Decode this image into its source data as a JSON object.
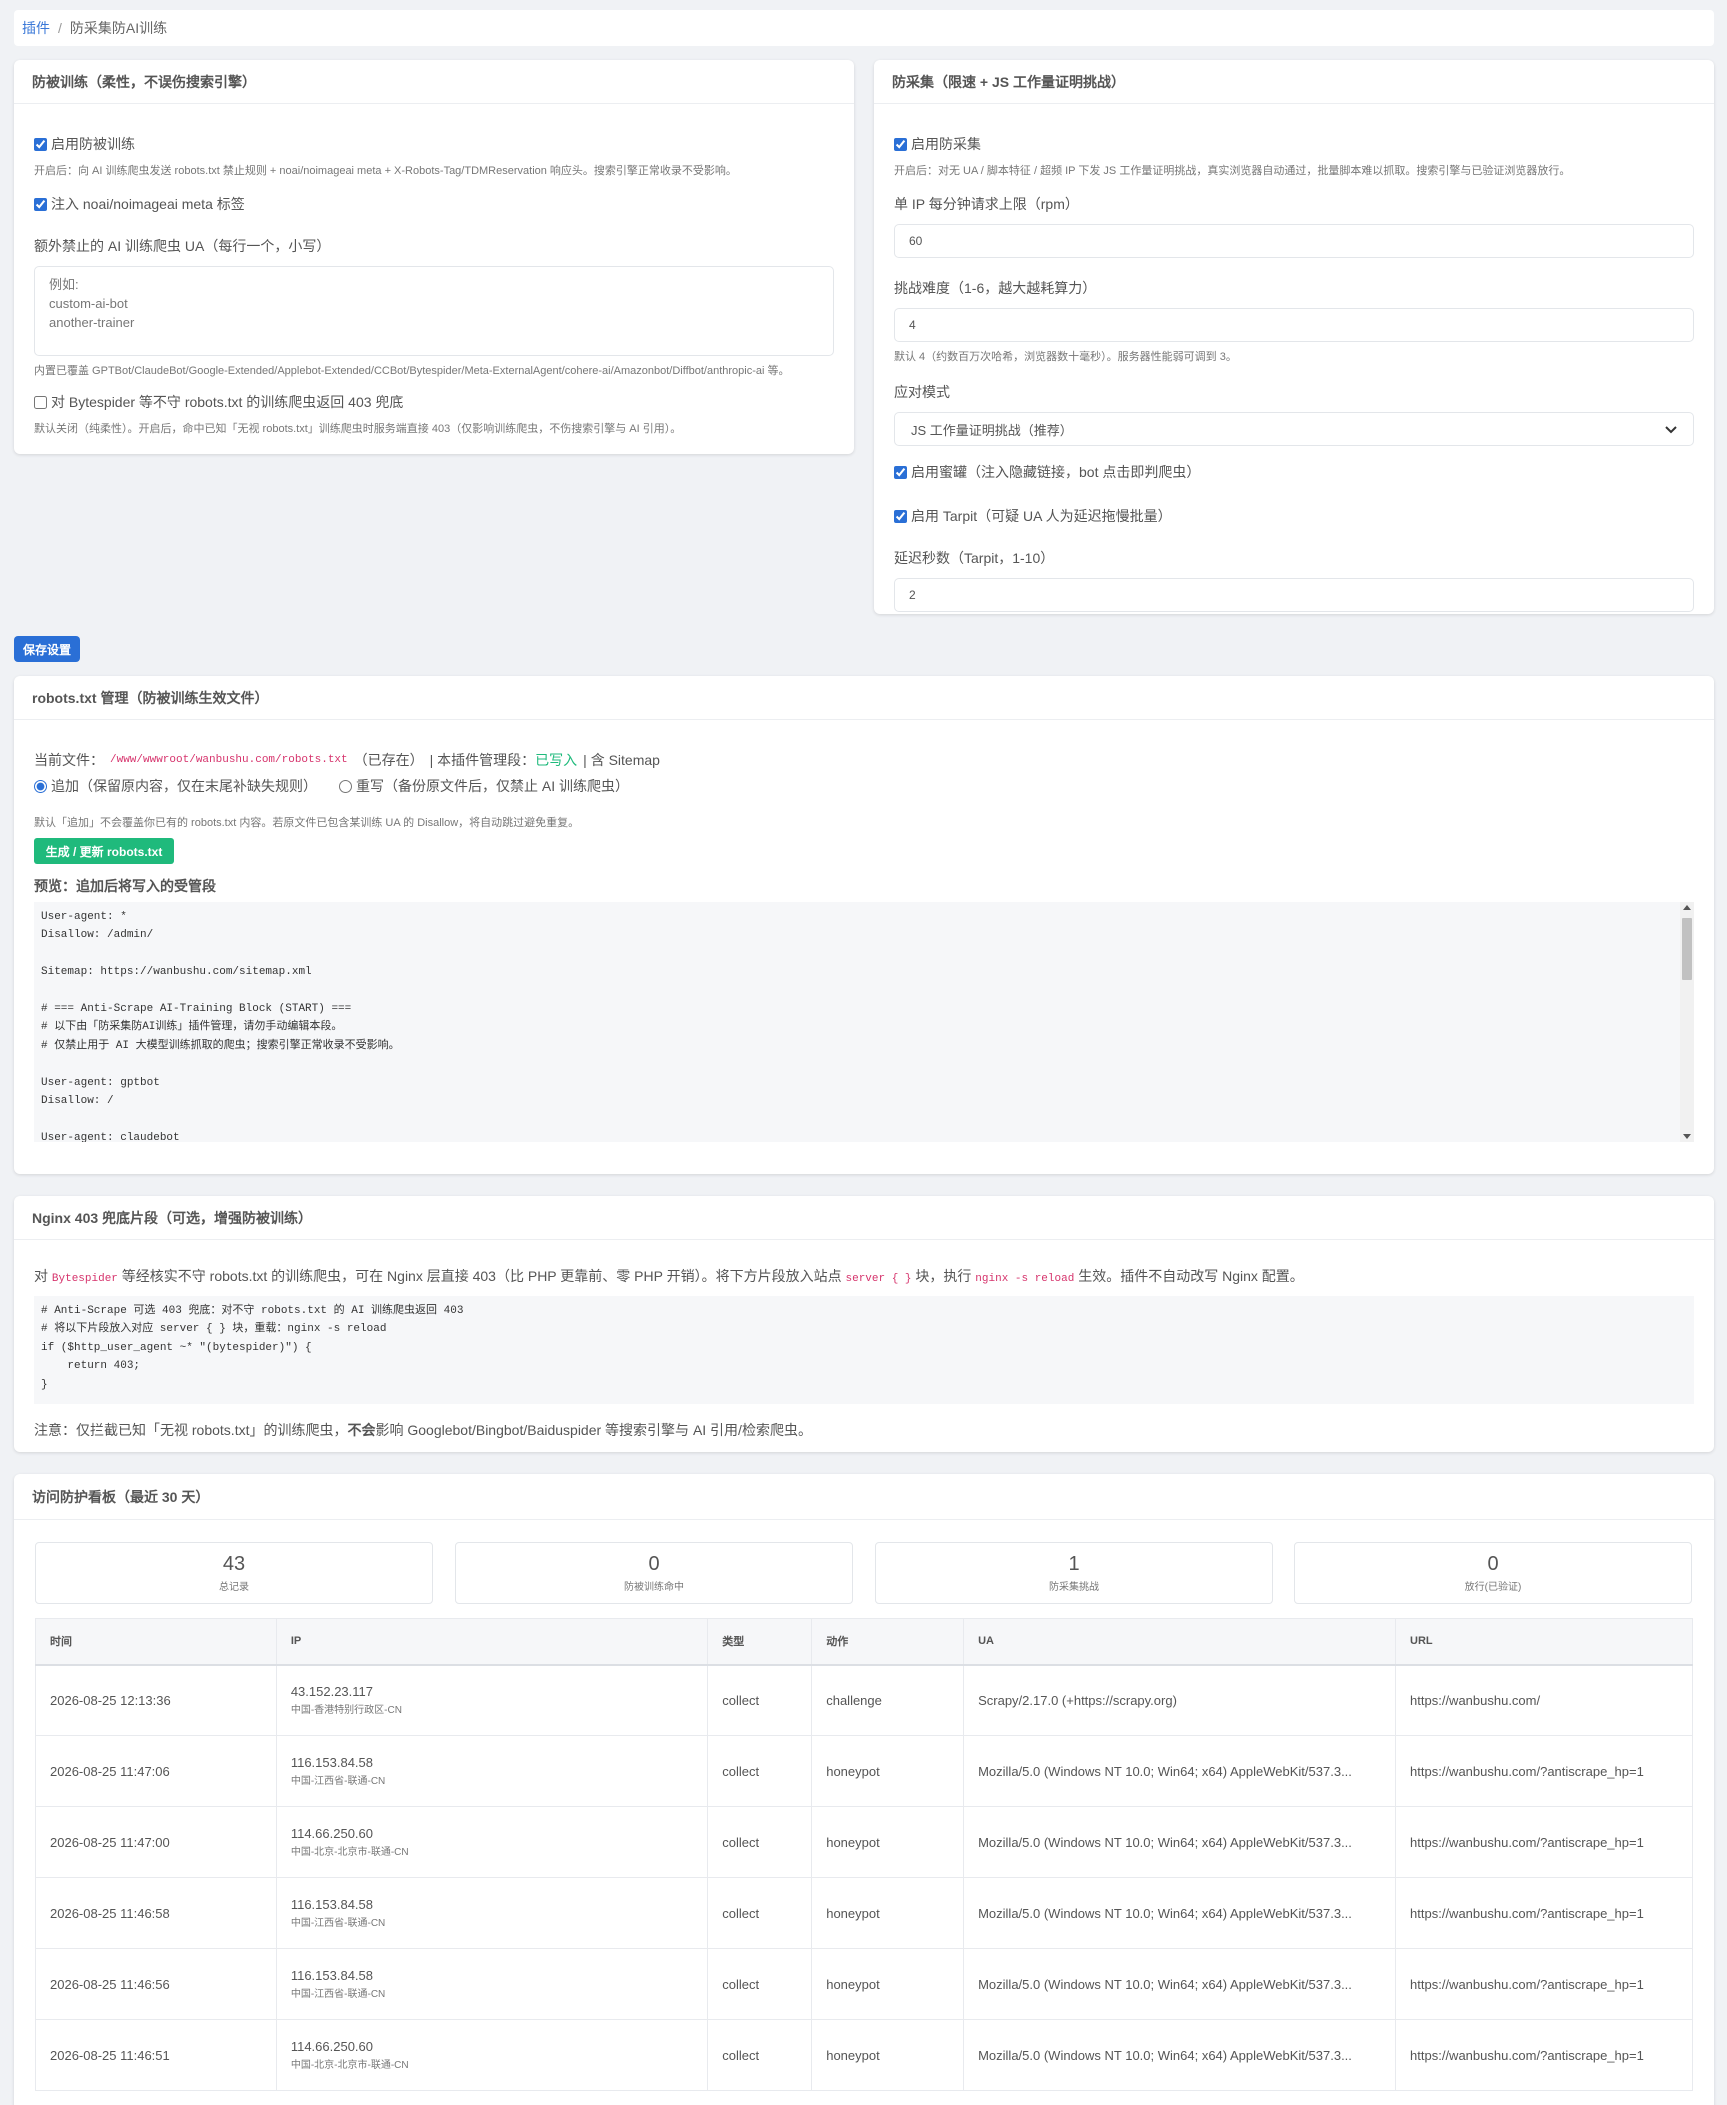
{
  "breadcrumb": {
    "link": "插件",
    "sep": "/",
    "current": "防采集防AI训练"
  },
  "train_card": {
    "title": "防被训练（柔性，不误伤搜索引擎）",
    "enable_label": "启用防被训练",
    "enable_help": "开启后：向 AI 训练爬虫发送 robots.txt 禁止规则 + noai/noimageai meta + X-Robots-Tag/TDMReservation 响应头。搜索引擎正常收录不受影响。",
    "meta_label": "注入 noai/noimageai meta 标签",
    "ua_label": "额外禁止的 AI 训练爬虫 UA（每行一个，小写）",
    "ua_placeholder": "例如:\ncustom-ai-bot\nanother-trainer",
    "ua_help": "内置已覆盖 GPTBot/ClaudeBot/Google-Extended/Applebot-Extended/CCBot/Bytespider/Meta-ExternalAgent/cohere-ai/Amazonbot/Diffbot/anthropic-ai 等。",
    "block_label": "对 Bytespider 等不守 robots.txt 的训练爬虫返回 403 兜底",
    "block_help": "默认关闭（纯柔性）。开启后，命中已知「无视 robots.txt」训练爬虫时服务端直接 403（仅影响训练爬虫，不伤搜索引擎与 AI 引用）。"
  },
  "scrape_card": {
    "title": "防采集（限速 + JS 工作量证明挑战）",
    "enable_label": "启用防采集",
    "enable_help": "开启后：对无 UA / 脚本特征 / 超频 IP 下发 JS 工作量证明挑战，真实浏览器自动通过，批量脚本难以抓取。搜索引擎与已验证浏览器放行。",
    "rpm_label": "单 IP 每分钟请求上限（rpm）",
    "rpm_value": "60",
    "difficulty_label": "挑战难度（1-6，越大越耗算力）",
    "difficulty_value": "4",
    "difficulty_help": "默认 4（约数百万次哈希，浏览器数十毫秒）。服务器性能弱可调到 3。",
    "mode_label": "应对模式",
    "mode_value": "JS 工作量证明挑战（推荐）",
    "honeypot_label": "启用蜜罐（注入隐藏链接，bot 点击即判爬虫）",
    "tarpit_label": "启用 Tarpit（可疑 UA 人为延迟拖慢批量）",
    "delay_label": "延迟秒数（Tarpit，1-10）",
    "delay_value": "2"
  },
  "save_button": "保存设置",
  "robots_card": {
    "title": "robots.txt 管理（防被训练生效文件）",
    "file_prefix": "当前文件：",
    "file_path": "/www/wwwroot/wanbushu.com/robots.txt",
    "file_status": "（已存在）",
    "managed_prefix": "| 本插件管理段：",
    "managed_value": "已写入",
    "sitemap_text": "| 含 Sitemap",
    "mode_append": "追加（保留原内容，仅在末尾补缺失规则）",
    "mode_overwrite": "重写（备份原文件后，仅禁止 AI 训练爬虫）",
    "mode_help": "默认「追加」不会覆盖你已有的 robots.txt 内容。若原文件已包含某训练 UA 的 Disallow，将自动跳过避免重复。",
    "generate_button": "生成 / 更新 robots.txt",
    "preview_title": "预览：追加后将写入的受管段",
    "preview_text": "User-agent: *\nDisallow: /admin/\n\nSitemap: https://wanbushu.com/sitemap.xml\n\n# === Anti-Scrape AI-Training Block (START) ===\n# 以下由「防采集防AI训练」插件管理，请勿手动编辑本段。\n# 仅禁止用于 AI 大模型训练抓取的爬虫；搜索引擎正常收录不受影响。\n\nUser-agent: gptbot\nDisallow: /\n\nUser-agent: claudebot"
  },
  "nginx_card": {
    "title": "Nginx 403 兜底片段（可选，增强防被训练）",
    "desc_1": "对 ",
    "desc_code_1": "Bytespider",
    "desc_2": " 等经核实不守 robots.txt 的训练爬虫，可在 Nginx 层直接 403（比 PHP 更靠前、零 PHP 开销）。将下方片段放入站点 ",
    "desc_code_2": "server { }",
    "desc_3": " 块，执行 ",
    "desc_code_3": "nginx -s reload",
    "desc_4": " 生效。插件不自动改写 Nginx 配置。",
    "snippet": "# Anti-Scrape 可选 403 兜底：对不守 robots.txt 的 AI 训练爬虫返回 403\n# 将以下片段放入对应 server { } 块，重载：nginx -s reload\nif ($http_user_agent ~* \"(bytespider)\") {\n    return 403;\n}",
    "note_1": "注意：仅拦截已知「无视 robots.txt」的训练爬虫，",
    "note_bold": "不会",
    "note_2": "影响 Googlebot/Bingbot/Baiduspider 等搜索引擎与 AI 引用/检索爬虫。"
  },
  "dashboard": {
    "title": "访问防护看板（最近 30 天）",
    "stats": [
      {
        "value": "43",
        "label": "总记录"
      },
      {
        "value": "0",
        "label": "防被训练命中"
      },
      {
        "value": "1",
        "label": "防采集挑战"
      },
      {
        "value": "0",
        "label": "放行(已验证)"
      }
    ],
    "columns": [
      "时间",
      "IP",
      "类型",
      "动作",
      "UA",
      "URL"
    ],
    "rows": [
      {
        "time": "2026-08-25 12:13:36",
        "ip": "43.152.23.117",
        "loc": "中国-香港特别行政区-CN",
        "type": "collect",
        "action": "challenge",
        "ua": "Scrapy/2.17.0 (+https://scrapy.org)",
        "url": "https://wanbushu.com/"
      },
      {
        "time": "2026-08-25 11:47:06",
        "ip": "116.153.84.58",
        "loc": "中国-江西省-联通-CN",
        "type": "collect",
        "action": "honeypot",
        "ua": "Mozilla/5.0 (Windows NT 10.0; Win64; x64) AppleWebKit/537.3...",
        "url": "https://wanbushu.com/?antiscrape_hp=1"
      },
      {
        "time": "2026-08-25 11:47:00",
        "ip": "114.66.250.60",
        "loc": "中国-北京-北京市-联通-CN",
        "type": "collect",
        "action": "honeypot",
        "ua": "Mozilla/5.0 (Windows NT 10.0; Win64; x64) AppleWebKit/537.3...",
        "url": "https://wanbushu.com/?antiscrape_hp=1"
      },
      {
        "time": "2026-08-25 11:46:58",
        "ip": "116.153.84.58",
        "loc": "中国-江西省-联通-CN",
        "type": "collect",
        "action": "honeypot",
        "ua": "Mozilla/5.0 (Windows NT 10.0; Win64; x64) AppleWebKit/537.3...",
        "url": "https://wanbushu.com/?antiscrape_hp=1"
      },
      {
        "time": "2026-08-25 11:46:56",
        "ip": "116.153.84.58",
        "loc": "中国-江西省-联通-CN",
        "type": "collect",
        "action": "honeypot",
        "ua": "Mozilla/5.0 (Windows NT 10.0; Win64; x64) AppleWebKit/537.3...",
        "url": "https://wanbushu.com/?antiscrape_hp=1"
      },
      {
        "time": "2026-08-25 11:46:51",
        "ip": "114.66.250.60",
        "loc": "中国-北京-北京市-联通-CN",
        "type": "collect",
        "action": "honeypot",
        "ua": "Mozilla/5.0 (Windows NT 10.0; Win64; x64) AppleWebKit/537.3...",
        "url": "https://wanbushu.com/?antiscrape_hp=1"
      }
    ]
  },
  "colors": {
    "primary": "#2a6fd6",
    "success": "#1fba7c",
    "code": "#d6336c"
  },
  "icons": {
    "select": "chevron-down-icon",
    "scroll_up": "scroll-up-arrow-icon",
    "scroll_down": "scroll-down-arrow-icon"
  }
}
